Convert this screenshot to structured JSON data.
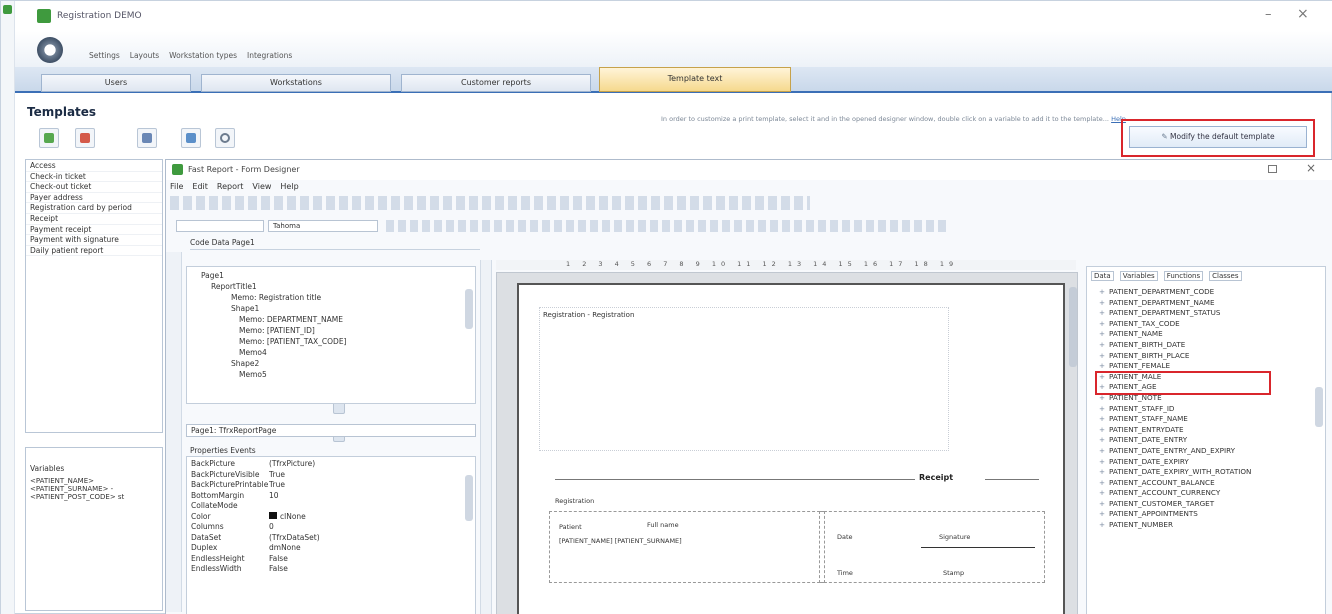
{
  "window": {
    "title": "Registration DEMO",
    "minimize_glyph": "–",
    "close_glyph": "×"
  },
  "ribbon": {
    "items": [
      "Settings",
      "Layouts",
      "Workstation types",
      "Integrations"
    ]
  },
  "tabs": [
    {
      "label": "Users",
      "active": false
    },
    {
      "label": "Workstations",
      "active": false
    },
    {
      "label": "Customer reports",
      "active": false
    },
    {
      "label": "Template text",
      "active": true
    }
  ],
  "page": {
    "title": "Templates",
    "hint": "In order to customize a print template, select it and in the opened designer window, double click on a variable to add it to the template...",
    "hint_link": "Help",
    "modify_button": "Modify the default template"
  },
  "template_list": {
    "items": [
      "Access",
      "Check-in ticket",
      "Check-out ticket",
      "Payer address",
      "Registration card by period",
      "Receipt",
      "Payment receipt",
      "Payment with signature",
      "Daily patient report"
    ]
  },
  "variables_panel": {
    "title": "Variables",
    "items": [
      "<PATIENT_NAME>",
      "<PATIENT_SURNAME> -",
      "<PATIENT_POST_CODE> st"
    ]
  },
  "designer": {
    "title": "Fast Report - Form Designer",
    "menu": [
      "File",
      "Edit",
      "Report",
      "View",
      "Help"
    ],
    "font_box": "Tahoma",
    "code_tabs": "Code   Data   Page1",
    "tree": [
      "Page1",
      "ReportTitle1",
      "Memo: Registration title",
      "Shape1",
      "Memo: DEPARTMENT_NAME",
      "Memo: [PATIENT_ID]",
      "Memo: [PATIENT_TAX_CODE]",
      "Memo4",
      "Shape2",
      "Memo5"
    ],
    "object_select": "Page1: TfrxReportPage",
    "props_tabs": "Properties   Events",
    "properties": [
      {
        "k": "BackPicture",
        "v": "(TfrxPicture)"
      },
      {
        "k": "BackPictureVisible",
        "v": "True"
      },
      {
        "k": "BackPicturePrintable",
        "v": "True"
      },
      {
        "k": "BottomMargin",
        "v": "10"
      },
      {
        "k": "CollateMode",
        "v": ""
      },
      {
        "k": "Color",
        "v": "clNone"
      },
      {
        "k": "Columns",
        "v": "0"
      },
      {
        "k": "DataSet",
        "v": "(TfrxDataSet)"
      },
      {
        "k": "Duplex",
        "v": "dmNone"
      },
      {
        "k": "EndlessHeight",
        "v": "False"
      },
      {
        "k": "EndlessWidth",
        "v": "False"
      }
    ],
    "ruler_digits": "1 2 3 4 5 6 7 8 9 10 11 12 13 14 15 16 17 18 19",
    "canvas": {
      "header_text": "Registration - Registration",
      "section_label": "Receipt",
      "sub_label": "Registration",
      "field_1": "Patient",
      "field_1_value": "Full name",
      "field_2": "[PATIENT_NAME] [PATIENT_SURNAME]",
      "right_label_1": "Date",
      "right_label_2": "Time",
      "right_value_1": "Signature",
      "right_value_2": "Stamp"
    },
    "right_tabs": [
      "Data",
      "Variables",
      "Functions",
      "Classes"
    ],
    "fields": [
      "PATIENT_DEPARTMENT_CODE",
      "PATIENT_DEPARTMENT_NAME",
      "PATIENT_DEPARTMENT_STATUS",
      "PATIENT_TAX_CODE",
      "PATIENT_NAME",
      "PATIENT_BIRTH_DATE",
      "PATIENT_BIRTH_PLACE",
      "PATIENT_FEMALE",
      "PATIENT_MALE",
      "PATIENT_AGE",
      "PATIENT_NOTE",
      "PATIENT_STAFF_ID",
      "PATIENT_STAFF_NAME",
      "PATIENT_ENTRYDATE",
      "PATIENT_DATE_ENTRY",
      "PATIENT_DATE_ENTRY_AND_EXPIRY",
      "PATIENT_DATE_EXPIRY",
      "PATIENT_DATE_EXPIRY_WITH_ROTATION",
      "PATIENT_ACCOUNT_BALANCE",
      "PATIENT_ACCOUNT_CURRENCY",
      "PATIENT_CUSTOMER_TARGET",
      "PATIENT_APPOINTMENTS",
      "PATIENT_NUMBER"
    ],
    "highlight_index": [
      8,
      9
    ]
  },
  "colors": {
    "accent_blue": "#3b6fb6",
    "tab_active": "#f6d98e",
    "highlight_red": "#d9262c",
    "chrome": "#e8eef5"
  }
}
